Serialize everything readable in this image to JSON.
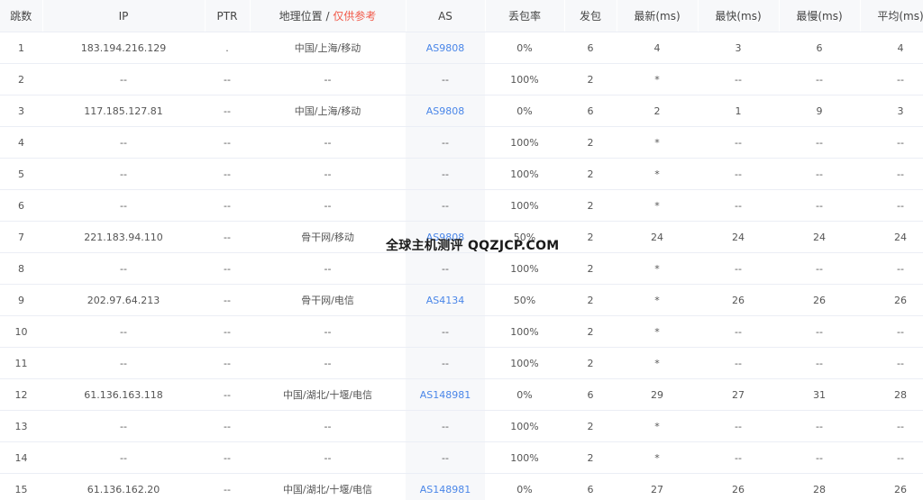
{
  "headers": {
    "hop": "跳数",
    "ip": "IP",
    "ptr": "PTR",
    "geo": "地理位置",
    "geo_sep": " / ",
    "geo_note": "仅供参考",
    "as": "AS",
    "loss": "丢包率",
    "sent": "发包",
    "last": "最新(ms)",
    "best": "最快(ms)",
    "worst": "最慢(ms)",
    "avg": "平均(ms)"
  },
  "rows": [
    {
      "hop": "1",
      "ip": "183.194.216.129",
      "ptr": ".",
      "geo": "中国/上海/移动",
      "as": "AS9808",
      "loss": "0%",
      "sent": "6",
      "last": "4",
      "best": "3",
      "worst": "6",
      "avg": "4"
    },
    {
      "hop": "2",
      "ip": "--",
      "ptr": "--",
      "geo": "--",
      "as": "--",
      "loss": "100%",
      "sent": "2",
      "last": "*",
      "best": "--",
      "worst": "--",
      "avg": "--"
    },
    {
      "hop": "3",
      "ip": "117.185.127.81",
      "ptr": "--",
      "geo": "中国/上海/移动",
      "as": "AS9808",
      "loss": "0%",
      "sent": "6",
      "last": "2",
      "best": "1",
      "worst": "9",
      "avg": "3"
    },
    {
      "hop": "4",
      "ip": "--",
      "ptr": "--",
      "geo": "--",
      "as": "--",
      "loss": "100%",
      "sent": "2",
      "last": "*",
      "best": "--",
      "worst": "--",
      "avg": "--"
    },
    {
      "hop": "5",
      "ip": "--",
      "ptr": "--",
      "geo": "--",
      "as": "--",
      "loss": "100%",
      "sent": "2",
      "last": "*",
      "best": "--",
      "worst": "--",
      "avg": "--"
    },
    {
      "hop": "6",
      "ip": "--",
      "ptr": "--",
      "geo": "--",
      "as": "--",
      "loss": "100%",
      "sent": "2",
      "last": "*",
      "best": "--",
      "worst": "--",
      "avg": "--"
    },
    {
      "hop": "7",
      "ip": "221.183.94.110",
      "ptr": "--",
      "geo": "骨干网/移动",
      "as": "AS9808",
      "loss": "50%",
      "sent": "2",
      "last": "24",
      "best": "24",
      "worst": "24",
      "avg": "24"
    },
    {
      "hop": "8",
      "ip": "--",
      "ptr": "--",
      "geo": "--",
      "as": "--",
      "loss": "100%",
      "sent": "2",
      "last": "*",
      "best": "--",
      "worst": "--",
      "avg": "--"
    },
    {
      "hop": "9",
      "ip": "202.97.64.213",
      "ptr": "--",
      "geo": "骨干网/电信",
      "as": "AS4134",
      "loss": "50%",
      "sent": "2",
      "last": "*",
      "best": "26",
      "worst": "26",
      "avg": "26"
    },
    {
      "hop": "10",
      "ip": "--",
      "ptr": "--",
      "geo": "--",
      "as": "--",
      "loss": "100%",
      "sent": "2",
      "last": "*",
      "best": "--",
      "worst": "--",
      "avg": "--"
    },
    {
      "hop": "11",
      "ip": "--",
      "ptr": "--",
      "geo": "--",
      "as": "--",
      "loss": "100%",
      "sent": "2",
      "last": "*",
      "best": "--",
      "worst": "--",
      "avg": "--"
    },
    {
      "hop": "12",
      "ip": "61.136.163.118",
      "ptr": "--",
      "geo": "中国/湖北/十堰/电信",
      "as": "AS148981",
      "loss": "0%",
      "sent": "6",
      "last": "29",
      "best": "27",
      "worst": "31",
      "avg": "28"
    },
    {
      "hop": "13",
      "ip": "--",
      "ptr": "--",
      "geo": "--",
      "as": "--",
      "loss": "100%",
      "sent": "2",
      "last": "*",
      "best": "--",
      "worst": "--",
      "avg": "--"
    },
    {
      "hop": "14",
      "ip": "--",
      "ptr": "--",
      "geo": "--",
      "as": "--",
      "loss": "100%",
      "sent": "2",
      "last": "*",
      "best": "--",
      "worst": "--",
      "avg": "--"
    },
    {
      "hop": "15",
      "ip": "61.136.162.20",
      "ptr": "--",
      "geo": "中国/湖北/十堰/电信",
      "as": "AS148981",
      "loss": "0%",
      "sent": "6",
      "last": "27",
      "best": "26",
      "worst": "28",
      "avg": "26"
    }
  ],
  "watermark": "全球主机测评 QQZJCP.COM",
  "colors": {
    "link": "#4a86e8",
    "note": "#f15a4a",
    "header_bg": "#f7f8fa"
  }
}
